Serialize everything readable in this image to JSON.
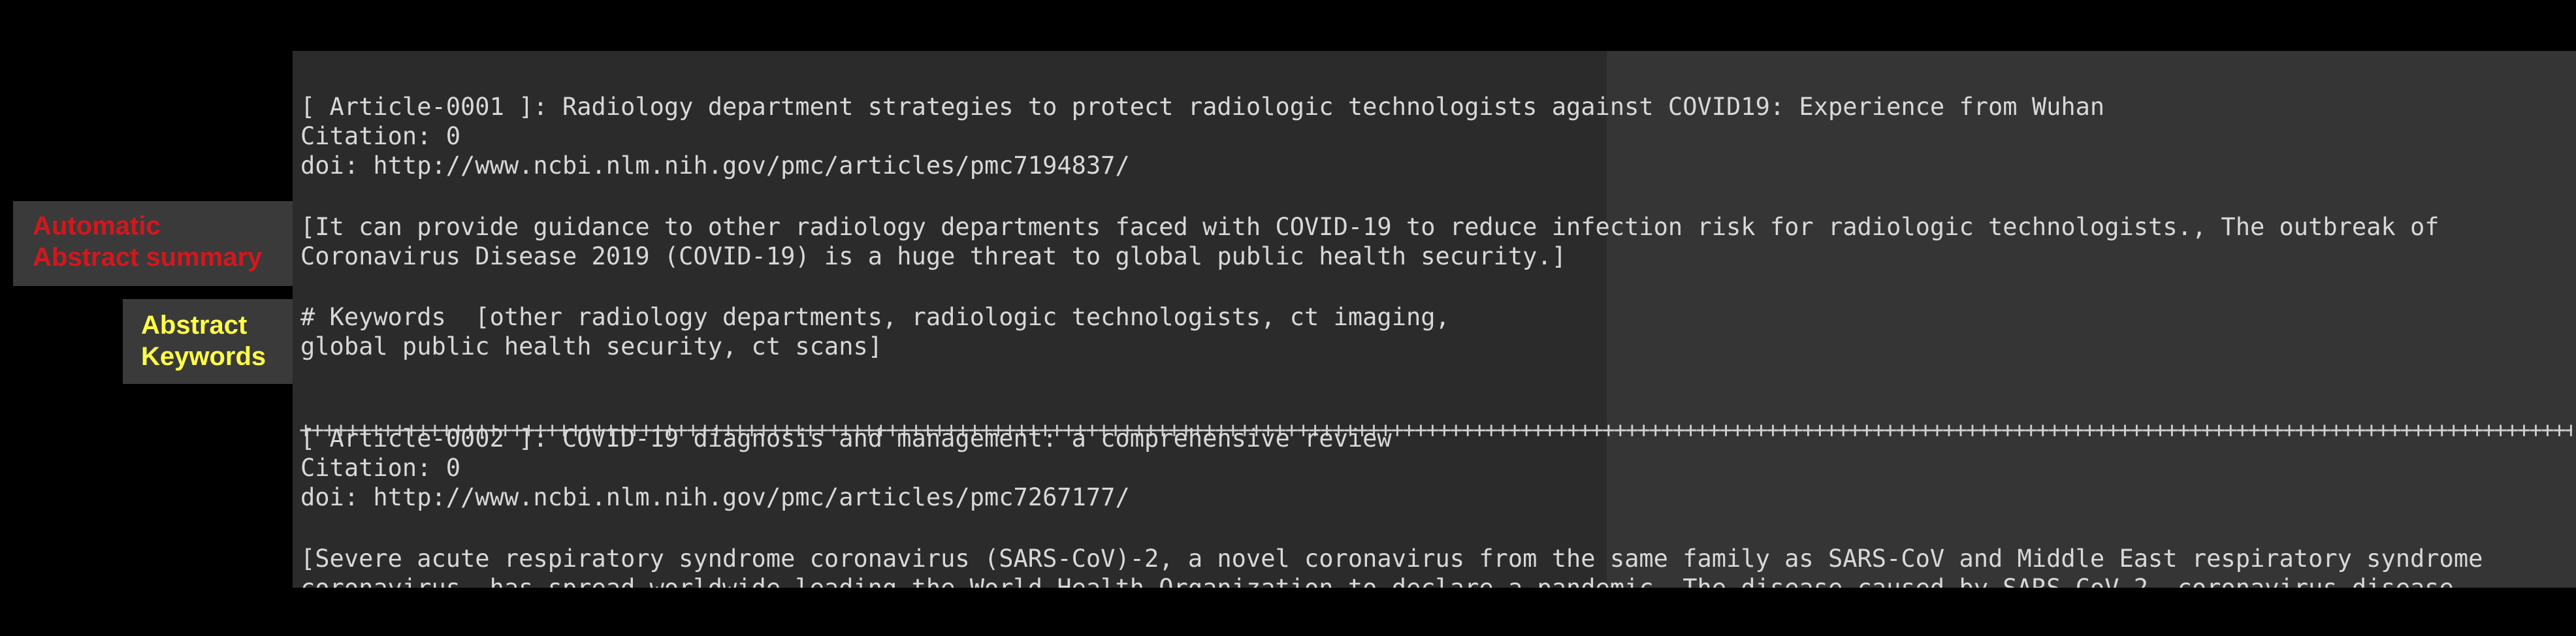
{
  "callouts": {
    "summary_line1": "Automatic",
    "summary_line2": "Abstract summary",
    "keywords_line1": "Abstract",
    "keywords_line2": "Keywords"
  },
  "articles": [
    {
      "header": "[ Article-0001 ]: Radiology department strategies to protect radiologic technologists against COVID19: Experience from Wuhan",
      "citation": "Citation: 0",
      "doi": "doi: http://www.ncbi.nlm.nih.gov/pmc/articles/pmc7194837/",
      "summary_line1": "[It can provide guidance to other radiology departments faced with COVID-19 to reduce infection risk for radiologic technologists., The outbreak of",
      "summary_line2": "Coronavirus Disease 2019 (COVID-19) is a huge threat to global public health security.]",
      "keywords_line1": "# Keywords  [other radiology departments, radiologic technologists, ct imaging,",
      "keywords_line2": "global public health security, ct scans]"
    },
    {
      "header": "[ Article-0002 ]: COVID-19 diagnosis and management: a comprehensive review",
      "citation": "Citation: 0",
      "doi": "doi: http://www.ncbi.nlm.nih.gov/pmc/articles/pmc7267177/",
      "summary_line1": "[Severe acute respiratory syndrome coronavirus (SARS-CoV)-2, a novel coronavirus from the same family as SARS-CoV and Middle East respiratory syndrome",
      "summary_line2": "coronavirus, has spread worldwide leading the World Health Organization to declare a pandemic. The disease caused by SARS-CoV-2, coronavirus disease"
    }
  ],
  "separator": "++++++++++++++++++++++++++++++++++++++++++++++++++++++++++++++++++++++++++++++++++++++++++++++++++++++++++++++++++++++++++++++++++++++++++++++++++++++++++++++++++++++++++++++++++++++++++++++++++++++++++++++++++++++++++++++++++++++++++++++++++++++++"
}
